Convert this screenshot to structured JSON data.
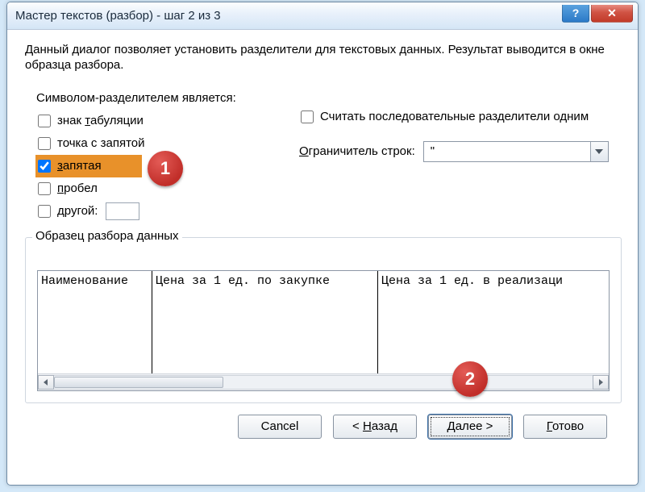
{
  "window": {
    "title": "Мастер текстов (разбор) - шаг 2 из 3"
  },
  "intro": "Данный диалог позволяет установить разделители для текстовых данных. Результат выводится в окне образца разбора.",
  "delimiters": {
    "legend": "Символом-разделителем является:",
    "tab": {
      "label": "знак табуляции",
      "checked": false
    },
    "semicolon": {
      "label": "точка с запятой",
      "checked": false
    },
    "comma": {
      "label": "запятая",
      "checked": true
    },
    "space": {
      "label": "пробел",
      "checked": false
    },
    "other": {
      "label": "другой:",
      "checked": false,
      "value": ""
    }
  },
  "treat_consecutive": {
    "label": "Считать последовательные разделители одним",
    "checked": false
  },
  "text_qualifier": {
    "label": "Ограничитель строк:",
    "value": "\""
  },
  "preview": {
    "legend": "Образец разбора данных",
    "columns": [
      "Наименование",
      "Цена за 1 ед. по закупке",
      "Цена за 1 ед. в реализаци"
    ]
  },
  "buttons": {
    "cancel": "Cancel",
    "back": "< Назад",
    "next": "Далее >",
    "finish": "Готово"
  },
  "callouts": {
    "one": "1",
    "two": "2"
  },
  "accent_color": "#e8912a"
}
